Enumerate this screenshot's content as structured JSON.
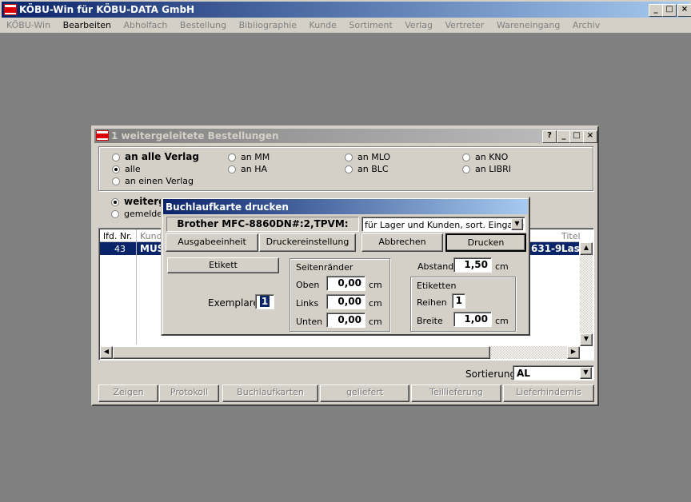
{
  "app": {
    "title": "KÖBU-Win für KÖBU-DATA GmbH",
    "logo_text": "KÖBU",
    "window_controls": [
      "_",
      "□",
      "×"
    ]
  },
  "menu": [
    "KÖBU-Win",
    "Bearbeiten",
    "Abholfach",
    "Bestellung",
    "Bibliographie",
    "Kunde",
    "Sortiment",
    "Verlag",
    "Vertreter",
    "Wareneingang",
    "Archiv"
  ],
  "orders_window": {
    "title": "1 weitergeleitete Bestellungen",
    "controls": [
      "?",
      "_",
      "□",
      "×"
    ],
    "radios": {
      "an_alle_verlag": "an alle Verlag",
      "alle": "alle",
      "an_einen_verlag": "an einen Verlag",
      "an_mm": "an MM",
      "an_ha": "an HA",
      "an_mlo": "an MLO",
      "an_blc": "an BLC",
      "an_kno": "an KNO",
      "an_libri": "an LIBRI",
      "weitergeleitet": "weiterge",
      "gemeldet": "gemeldet"
    },
    "table": {
      "headers": [
        "lfd. Nr.",
        "Kunde",
        "Titel"
      ],
      "row": {
        "nr": "43",
        "kunde": "MUS",
        "isbn": "631-9",
        "titel": "Lass"
      }
    },
    "sortierung_label": "Sortierung",
    "sortierung_value": "AL",
    "buttons": [
      "Zeigen",
      "Protokoll",
      "Buchlaufkarten",
      "geliefert",
      "Teillieferung",
      "Lieferhindernis"
    ]
  },
  "dialog": {
    "title": "Buchlaufkarte drucken",
    "printer": "Brother MFC-8860DN#:2,TPVM:",
    "mode_select": "für Lager und Kunden, sort. Eingabe",
    "buttons": {
      "ausgabe": "Ausgabeeinheit",
      "druckereinstellung": "Druckereinstellung",
      "abbrechen": "Abbrechen",
      "drucken": "Drucken",
      "etikett": "Etikett"
    },
    "exemplare_label": "Exemplare",
    "exemplare_value": "1",
    "seitenraender": {
      "title": "Seitenränder",
      "oben_label": "Oben",
      "oben": "0,00",
      "links_label": "Links",
      "links": "0,00",
      "unten_label": "Unten",
      "unten": "0,00",
      "unit": "cm"
    },
    "abstand_label": "Abstand",
    "abstand": "1,50",
    "etiketten": {
      "title": "Etiketten",
      "reihen_label": "Reihen",
      "reihen": "1",
      "breite_label": "Breite",
      "breite": "1,00",
      "unit": "cm"
    },
    "unit": "cm"
  }
}
